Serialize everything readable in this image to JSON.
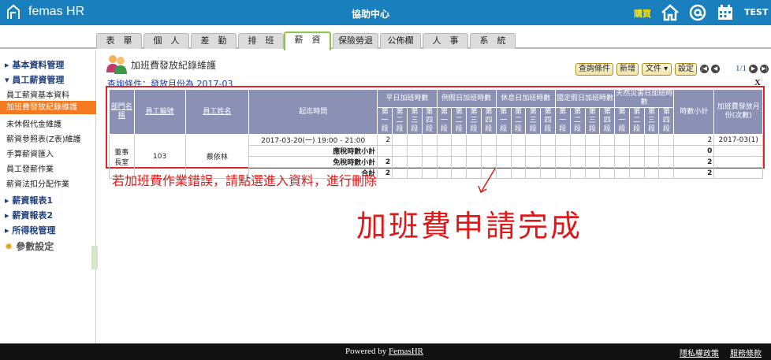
{
  "header": {
    "logo_text": "femas HR",
    "center_title": "協助中心",
    "buy_label": "購買",
    "user": "TEST"
  },
  "tabs": [
    "表　單",
    "個　人",
    "差　勤",
    "排　班",
    "薪　資",
    "保險勞退",
    "公佈欄",
    "人　事",
    "系　統"
  ],
  "sidebar": {
    "sections": [
      {
        "label": "▸ 基本資料管理"
      },
      {
        "label": "▾ 員工薪資管理"
      },
      {
        "label": "▸ 薪資報表1"
      },
      {
        "label": "▸ 薪資報表2"
      },
      {
        "label": "▸ 所得稅管理"
      },
      {
        "label": "參數設定"
      }
    ],
    "items": [
      "員工薪資基本資料",
      "加班費發放紀錄維護",
      "未休假代金維護",
      "薪資參照表(Z表)維護",
      "手算薪資匯入",
      "員工發薪作業",
      "薪資法扣分配作業"
    ]
  },
  "main": {
    "page_title": "加班費發放紀錄維護",
    "buttons": {
      "query": "查詢條件",
      "add": "新增",
      "file": "文件 ▾",
      "settings": "設定"
    },
    "pagination": "1/1",
    "query_text": "查詢條件：發放月份為 2017-03",
    "close_label": "X"
  },
  "table": {
    "headers": {
      "dept": "部門名稱",
      "emp_no": "員工編號",
      "emp_name": "員工姓名",
      "period": "起迄時間",
      "groups": [
        "平日加班時數",
        "例假日加班時數",
        "休息日加班時數",
        "國定假日加班時數",
        "天然災害日加班時數"
      ],
      "sub": [
        "第一段",
        "第二段",
        "第三段",
        "第四段"
      ],
      "total_hours": "時數小計",
      "issue_month": "加班費發放月份(次數)"
    },
    "row": {
      "dept": "董事長室",
      "emp_no": "103",
      "emp_name": "蔡依林",
      "period": "2017-03-20(一) 19:00 - 21:00",
      "p1": "2",
      "total": "2",
      "month": "2017-03(1)",
      "taxable_label": "應稅時數小計",
      "taxable_total": "0",
      "exempt_label": "免稅時數小計",
      "exempt_p1": "2",
      "exempt_total": "2",
      "sum_label": "合計",
      "sum_p1": "2",
      "sum_total": "2"
    }
  },
  "annotation": {
    "note": "若加班費作業錯誤，請點選進入資料，進行刪除",
    "big": "加班費申請完成"
  },
  "footer": {
    "powered_prefix": "Powered by ",
    "powered_brand": "FemasHR",
    "privacy": "隱私權政策",
    "terms": "服務條款"
  },
  "colors": {
    "topbar": "#1a80bd",
    "accent": "#f47920",
    "annotation": "#e01818",
    "table_header": "#8b91b5"
  }
}
